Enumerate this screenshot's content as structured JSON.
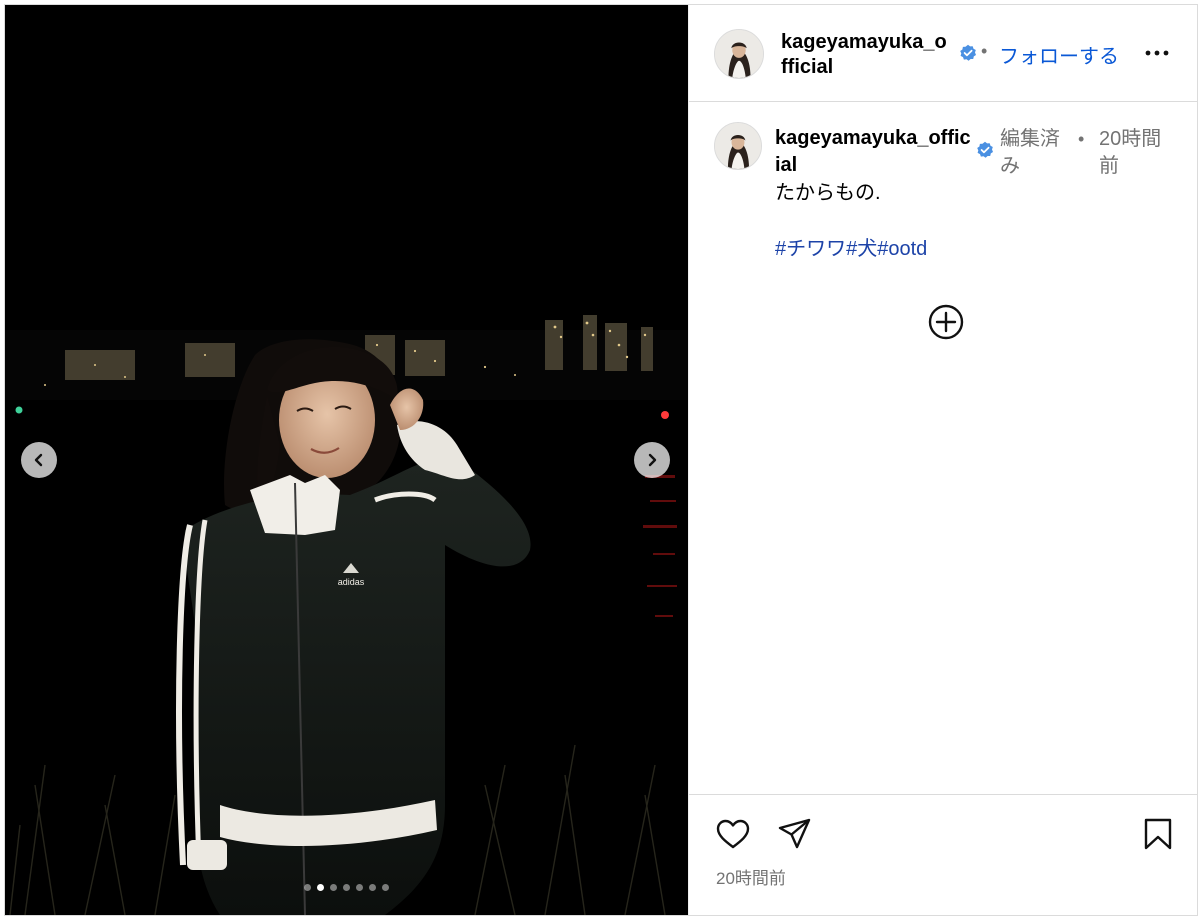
{
  "header": {
    "username": "kageyamayuka_official",
    "separator": "•",
    "follow_label": "フォローする"
  },
  "caption": {
    "username": "kageyamayuka_official",
    "edited_label": "編集済み",
    "separator": "•",
    "time_ago": "20時間前",
    "text": "たからもの.",
    "hashtags": [
      "#チワワ",
      "#犬",
      "#ootd"
    ]
  },
  "media": {
    "photo_count": 7,
    "active_index": 1,
    "jacket_logo_text": "adidas"
  },
  "footer": {
    "timestamp": "20時間前"
  },
  "icons": {
    "verified": "verified-badge-icon",
    "more": "more-options-icon",
    "load_more": "add-circle-icon",
    "like": "heart-icon",
    "share": "share-icon",
    "save": "bookmark-icon",
    "prev": "chevron-left-icon",
    "next": "chevron-right-icon"
  },
  "colors": {
    "follow": "#0a58d6",
    "hashtag": "#1d43a8",
    "verified": "#4a90e2",
    "secondary_text": "#737373",
    "divider": "#dbdbdb"
  }
}
